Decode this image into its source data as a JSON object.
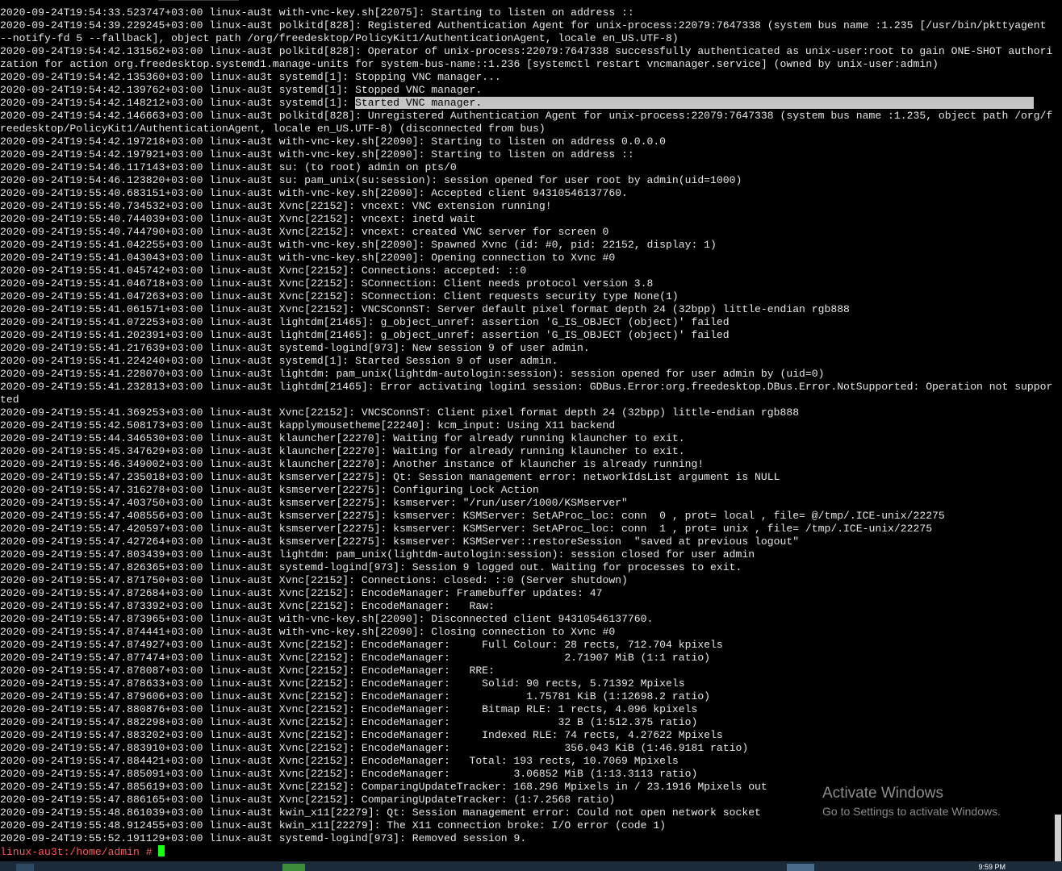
{
  "terminal": {
    "lines": [
      "2020-09-24T19:54:33.523747+03:00 linux-au3t with-vnc-key.sh[22075]: Starting to listen on address ::",
      "2020-09-24T19:54:39.229245+03:00 linux-au3t polkitd[828]: Registered Authentication Agent for unix-process:22079:7647338 (system bus name :1.235 [/usr/bin/pkttyagent --notify-fd 5 --fallback], object path /org/freedesktop/PolicyKit1/AuthenticationAgent, locale en_US.UTF-8)",
      "2020-09-24T19:54:42.131562+03:00 linux-au3t polkitd[828]: Operator of unix-process:22079:7647338 successfully authenticated as unix-user:root to gain ONE-SHOT authorization for action org.freedesktop.systemd1.manage-units for system-bus-name::1.236 [systemctl restart vncmanager.service] (owned by unix-user:admin)",
      "2020-09-24T19:54:42.135360+03:00 linux-au3t systemd[1]: Stopping VNC manager...",
      "2020-09-24T19:54:42.139762+03:00 linux-au3t systemd[1]: Stopped VNC manager.",
      "2020-09-24T19:54:42.148212+03:00 linux-au3t systemd[1]: Started VNC manager.",
      "2020-09-24T19:54:42.146663+03:00 linux-au3t polkitd[828]: Unregistered Authentication Agent for unix-process:22079:7647338 (system bus name :1.235, object path /org/freedesktop/PolicyKit1/AuthenticationAgent, locale en_US.UTF-8) (disconnected from bus)",
      "2020-09-24T19:54:42.197218+03:00 linux-au3t with-vnc-key.sh[22090]: Starting to listen on address 0.0.0.0",
      "2020-09-24T19:54:42.197921+03:00 linux-au3t with-vnc-key.sh[22090]: Starting to listen on address ::",
      "2020-09-24T19:54:46.117143+03:00 linux-au3t su: (to root) admin on pts/0",
      "2020-09-24T19:54:46.123820+03:00 linux-au3t su: pam_unix(su:session): session opened for user root by admin(uid=1000)",
      "2020-09-24T19:55:40.683151+03:00 linux-au3t with-vnc-key.sh[22090]: Accepted client 94310546137760.",
      "2020-09-24T19:55:40.734532+03:00 linux-au3t Xvnc[22152]: vncext: VNC extension running!",
      "2020-09-24T19:55:40.744039+03:00 linux-au3t Xvnc[22152]: vncext: inetd wait",
      "2020-09-24T19:55:40.744790+03:00 linux-au3t Xvnc[22152]: vncext: created VNC server for screen 0",
      "2020-09-24T19:55:41.042255+03:00 linux-au3t with-vnc-key.sh[22090]: Spawned Xvnc (id: #0, pid: 22152, display: 1)",
      "2020-09-24T19:55:41.043043+03:00 linux-au3t with-vnc-key.sh[22090]: Opening connection to Xvnc #0",
      "2020-09-24T19:55:41.045742+03:00 linux-au3t Xvnc[22152]: Connections: accepted: ::0",
      "2020-09-24T19:55:41.046718+03:00 linux-au3t Xvnc[22152]: SConnection: Client needs protocol version 3.8",
      "2020-09-24T19:55:41.047263+03:00 linux-au3t Xvnc[22152]: SConnection: Client requests security type None(1)",
      "2020-09-24T19:55:41.061571+03:00 linux-au3t Xvnc[22152]: VNCSConnST: Server default pixel format depth 24 (32bpp) little-endian rgb888",
      "2020-09-24T19:55:41.072253+03:00 linux-au3t lightdm[21465]: g_object_unref: assertion 'G_IS_OBJECT (object)' failed",
      "2020-09-24T19:55:41.202391+03:00 linux-au3t lightdm[21465]: g_object_unref: assertion 'G_IS_OBJECT (object)' failed",
      "2020-09-24T19:55:41.217639+03:00 linux-au3t systemd-logind[973]: New session 9 of user admin.",
      "2020-09-24T19:55:41.224240+03:00 linux-au3t systemd[1]: Started Session 9 of user admin.",
      "2020-09-24T19:55:41.228070+03:00 linux-au3t lightdm: pam_unix(lightdm-autologin:session): session opened for user admin by (uid=0)",
      "2020-09-24T19:55:41.232813+03:00 linux-au3t lightdm[21465]: Error activating login1 session: GDBus.Error:org.freedesktop.DBus.Error.NotSupported: Operation not supported",
      "2020-09-24T19:55:41.369253+03:00 linux-au3t Xvnc[22152]: VNCSConnST: Client pixel format depth 24 (32bpp) little-endian rgb888",
      "2020-09-24T19:55:42.508173+03:00 linux-au3t kapplymousetheme[22240]: kcm_input: Using X11 backend",
      "2020-09-24T19:55:44.346530+03:00 linux-au3t klauncher[22270]: Waiting for already running klauncher to exit.",
      "2020-09-24T19:55:45.347629+03:00 linux-au3t klauncher[22270]: Waiting for already running klauncher to exit.",
      "2020-09-24T19:55:46.349002+03:00 linux-au3t klauncher[22270]: Another instance of klauncher is already running!",
      "2020-09-24T19:55:47.235018+03:00 linux-au3t ksmserver[22275]: Qt: Session management error: networkIdsList argument is NULL",
      "2020-09-24T19:55:47.316278+03:00 linux-au3t ksmserver[22275]: Configuring Lock Action",
      "2020-09-24T19:55:47.403750+03:00 linux-au3t ksmserver[22275]: ksmserver: \"/run/user/1000/KSMserver\"",
      "2020-09-24T19:55:47.408556+03:00 linux-au3t ksmserver[22275]: ksmserver: KSMServer: SetAProc_loc: conn  0 , prot= local , file= @/tmp/.ICE-unix/22275",
      "2020-09-24T19:55:47.420597+03:00 linux-au3t ksmserver[22275]: ksmserver: KSMServer: SetAProc_loc: conn  1 , prot= unix , file= /tmp/.ICE-unix/22275",
      "2020-09-24T19:55:47.427264+03:00 linux-au3t ksmserver[22275]: ksmserver: KSMServer::restoreSession  \"saved at previous logout\"",
      "2020-09-24T19:55:47.803439+03:00 linux-au3t lightdm: pam_unix(lightdm-autologin:session): session closed for user admin",
      "2020-09-24T19:55:47.826365+03:00 linux-au3t systemd-logind[973]: Session 9 logged out. Waiting for processes to exit.",
      "2020-09-24T19:55:47.871750+03:00 linux-au3t Xvnc[22152]: Connections: closed: ::0 (Server shutdown)",
      "2020-09-24T19:55:47.872684+03:00 linux-au3t Xvnc[22152]: EncodeManager: Framebuffer updates: 47",
      "2020-09-24T19:55:47.873392+03:00 linux-au3t Xvnc[22152]: EncodeManager:   Raw:",
      "2020-09-24T19:55:47.873965+03:00 linux-au3t with-vnc-key.sh[22090]: Disconnected client 94310546137760.",
      "2020-09-24T19:55:47.874441+03:00 linux-au3t with-vnc-key.sh[22090]: Closing connection to Xvnc #0",
      "2020-09-24T19:55:47.874927+03:00 linux-au3t Xvnc[22152]: EncodeManager:     Full Colour: 28 rects, 712.704 kpixels",
      "2020-09-24T19:55:47.877474+03:00 linux-au3t Xvnc[22152]: EncodeManager:                  2.71907 MiB (1:1 ratio)",
      "2020-09-24T19:55:47.878087+03:00 linux-au3t Xvnc[22152]: EncodeManager:   RRE:",
      "2020-09-24T19:55:47.878633+03:00 linux-au3t Xvnc[22152]: EncodeManager:     Solid: 90 rects, 5.71392 Mpixels",
      "2020-09-24T19:55:47.879606+03:00 linux-au3t Xvnc[22152]: EncodeManager:            1.75781 KiB (1:12698.2 ratio)",
      "2020-09-24T19:55:47.880876+03:00 linux-au3t Xvnc[22152]: EncodeManager:     Bitmap RLE: 1 rects, 4.096 kpixels",
      "2020-09-24T19:55:47.882298+03:00 linux-au3t Xvnc[22152]: EncodeManager:                 32 B (1:512.375 ratio)",
      "2020-09-24T19:55:47.883202+03:00 linux-au3t Xvnc[22152]: EncodeManager:     Indexed RLE: 74 rects, 4.27622 Mpixels",
      "2020-09-24T19:55:47.883910+03:00 linux-au3t Xvnc[22152]: EncodeManager:                  356.043 KiB (1:46.9181 ratio)",
      "2020-09-24T19:55:47.884421+03:00 linux-au3t Xvnc[22152]: EncodeManager:   Total: 193 rects, 10.7069 Mpixels",
      "2020-09-24T19:55:47.885091+03:00 linux-au3t Xvnc[22152]: EncodeManager:          3.06852 MiB (1:13.3113 ratio)",
      "2020-09-24T19:55:47.885619+03:00 linux-au3t Xvnc[22152]: ComparingUpdateTracker: 168.296 Mpixels in / 23.1916 Mpixels out",
      "2020-09-24T19:55:47.886165+03:00 linux-au3t Xvnc[22152]: ComparingUpdateTracker: (1:7.2568 ratio)",
      "2020-09-24T19:55:48.861039+03:00 linux-au3t kwin_x11[22279]: Qt: Session management error: Could not open network socket",
      "2020-09-24T19:55:48.912455+03:00 linux-au3t kwin_x11[22279]: The X11 connection broke: I/O error (code 1)",
      "2020-09-24T19:55:52.191129+03:00 linux-au3t systemd-logind[973]: Removed session 9."
    ],
    "selected_line_index": 5,
    "selected_text": "Started VNC manager.",
    "prompt": "linux-au3t:/home/admin # ",
    "colors": {
      "background": "#000000",
      "foreground": "#e6e6e6",
      "prompt": "#ff5a5a",
      "cursor": "#16ff16",
      "selection": "#c4c4c4"
    }
  },
  "watermark": {
    "title": "Activate Windows",
    "subtitle": "Go to Settings to activate Windows."
  },
  "taskbar": {
    "clock": "9:59 PM"
  }
}
